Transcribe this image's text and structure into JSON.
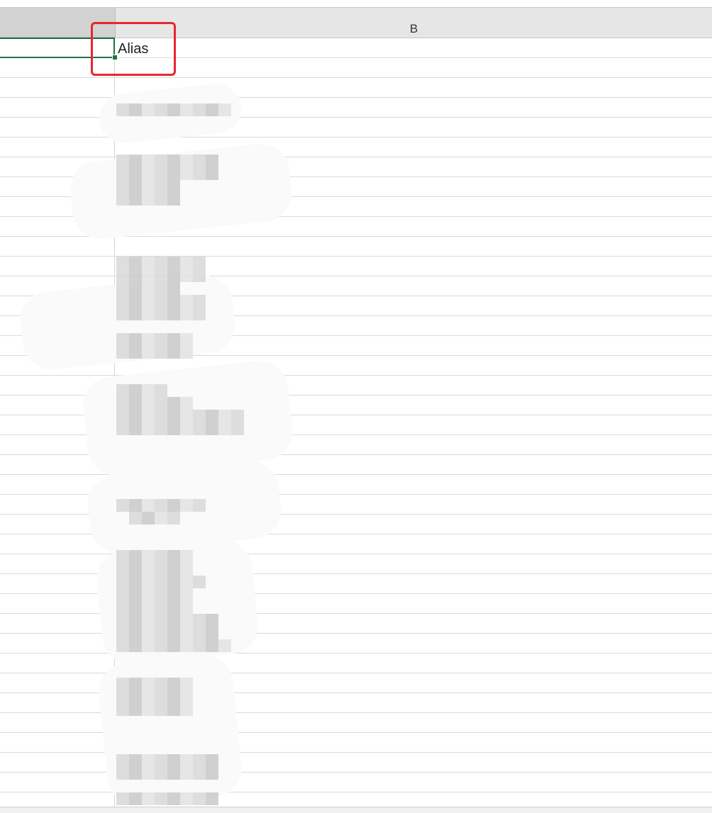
{
  "sheet": {
    "columns": [
      {
        "label": ""
      },
      {
        "label": "B"
      }
    ],
    "selected_cell": "B1",
    "cells": {
      "b1": "Alias"
    }
  },
  "annotation": {
    "highlight_color": "#e8262e"
  },
  "colors": {
    "selection": "#217346",
    "header_bg": "#e6e6e6",
    "selected_header_bg": "#d2d2d2"
  }
}
